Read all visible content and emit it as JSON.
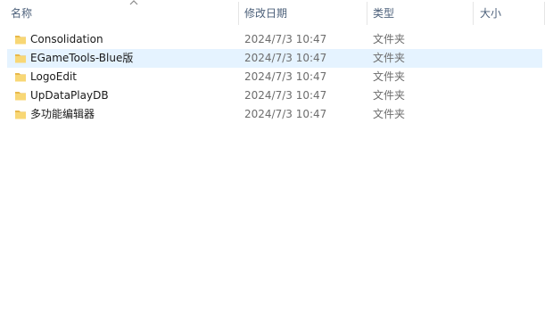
{
  "columns": {
    "name": "名称",
    "date": "修改日期",
    "type": "类型",
    "size": "大小"
  },
  "rows": [
    {
      "name": "Consolidation",
      "date": "2024/7/3 10:47",
      "type": "文件夹",
      "size": ""
    },
    {
      "name": "EGameTools-Blue版",
      "date": "2024/7/3 10:47",
      "type": "文件夹",
      "size": ""
    },
    {
      "name": "LogoEdit",
      "date": "2024/7/3 10:47",
      "type": "文件夹",
      "size": ""
    },
    {
      "name": "UpDataPlayDB",
      "date": "2024/7/3 10:47",
      "type": "文件夹",
      "size": ""
    },
    {
      "name": "多功能编辑器",
      "date": "2024/7/3 10:47",
      "type": "文件夹",
      "size": ""
    }
  ],
  "icons": {
    "folder": "folder-icon",
    "sort": "sort-ascending-icon"
  },
  "colors": {
    "folder": "#f8d775",
    "header_text": "#4c607a",
    "hover": "#e5f3ff"
  }
}
